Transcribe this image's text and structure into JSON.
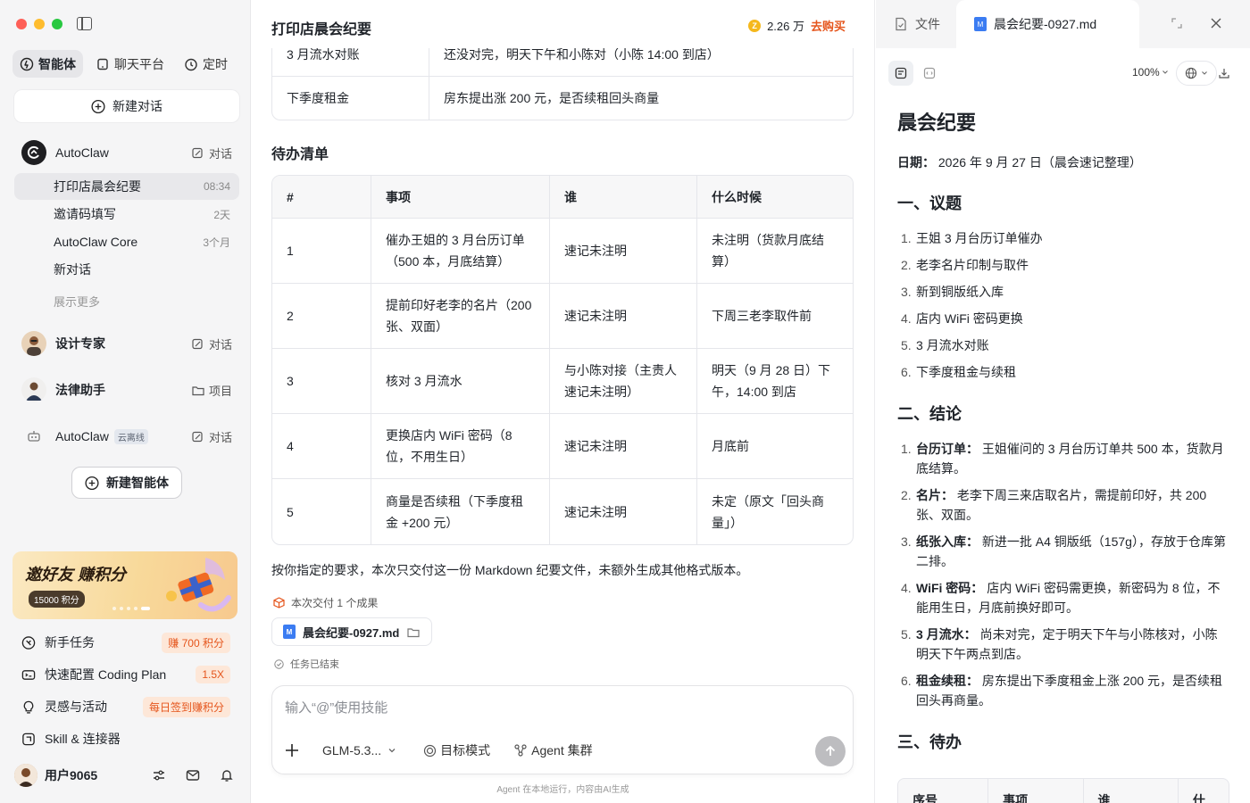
{
  "sidebar": {
    "tabs": [
      {
        "label": "智能体",
        "icon": "agent-icon"
      },
      {
        "label": "聊天平台",
        "icon": "chat-platform-icon"
      },
      {
        "label": "定时",
        "icon": "clock-icon"
      }
    ],
    "new_chat": "新建对话",
    "agents": {
      "autoclaw": {
        "name": "AutoClaw",
        "action": "对话"
      },
      "design": {
        "name": "设计专家",
        "action": "对话"
      },
      "legal": {
        "name": "法律助手",
        "action": "项目"
      },
      "cloud": {
        "name": "AutoClaw",
        "badge": "云离线",
        "action": "对话"
      }
    },
    "conversations": [
      {
        "title": "打印店晨会纪要",
        "time": "08:34"
      },
      {
        "title": "邀请码填写",
        "time": "2天"
      },
      {
        "title": "AutoClaw Core",
        "time": "3个月"
      },
      {
        "title": "新对话",
        "time": ""
      }
    ],
    "show_more": "展示更多",
    "new_agent": "新建智能体",
    "banner": {
      "title": "邀好友 赚积分",
      "pill": "15000 积分"
    },
    "menu": [
      {
        "label": "新手任务",
        "badge": "赚 700 积分",
        "icon": "task-icon"
      },
      {
        "label": "快速配置 Coding Plan",
        "badge": "1.5X",
        "icon": "code-icon"
      },
      {
        "label": "灵感与活动",
        "badge": "每日签到赚积分",
        "icon": "bulb-icon"
      },
      {
        "label": "Skill & 连接器",
        "badge": "",
        "icon": "plug-icon"
      }
    ],
    "user": {
      "name": "用户9065"
    }
  },
  "main": {
    "title": "打印店晨会纪要",
    "points": "2.26 万",
    "buy": "去购买",
    "prev_table": [
      {
        "item": "3 月流水对账",
        "note": "还没对完，明天下午和小陈对（小陈 14:00 到店）"
      },
      {
        "item": "下季度租金",
        "note": "房东提出涨 200 元，是否续租回头商量"
      }
    ],
    "todo_heading": "待办清单",
    "todo_headers": [
      "#",
      "事项",
      "谁",
      "什么时候"
    ],
    "todo_rows": [
      {
        "n": "1",
        "item": "催办王姐的 3 月台历订单（500 本，月底结算）",
        "who": "速记未注明",
        "when": "未注明（货款月底结算）"
      },
      {
        "n": "2",
        "item": "提前印好老李的名片（200 张、双面）",
        "who": "速记未注明",
        "when": "下周三老李取件前"
      },
      {
        "n": "3",
        "item": "核对 3 月流水",
        "who": "与小陈对接（主责人速记未注明）",
        "when": "明天（9 月 28 日）下午，14:00 到店"
      },
      {
        "n": "4",
        "item": "更换店内 WiFi 密码（8 位，不用生日）",
        "who": "速记未注明",
        "when": "月底前"
      },
      {
        "n": "5",
        "item": "商量是否续租（下季度租金 +200 元）",
        "who": "速记未注明",
        "when": "未定（原文「回头商量」）"
      }
    ],
    "summary": "按你指定的要求，本次只交付这一份 Markdown 纪要文件，未额外生成其他格式版本。",
    "deliver_label": "本次交付 1 个成果",
    "file_name": "晨会纪要-0927.md",
    "task_status": "任务已结束",
    "composer": {
      "placeholder": "输入“@”使用技能",
      "model": "GLM-5.3...",
      "goal_mode": "目标模式",
      "agent_cluster": "Agent 集群"
    },
    "footnote": "Agent 在本地运行，内容由AI生成"
  },
  "right": {
    "tab_files": "文件",
    "tab_doc": "晨会纪要-0927.md",
    "zoom": "100%",
    "doc": {
      "title": "晨会纪要",
      "date_label": "日期：",
      "date_value": "2026 年 9 月 27 日（晨会速记整理）",
      "sec1": "一、议题",
      "agenda": [
        "王姐 3 月台历订单催办",
        "老李名片印制与取件",
        "新到铜版纸入库",
        "店内 WiFi 密码更换",
        "3 月流水对账",
        "下季度租金与续租"
      ],
      "sec2": "二、结论",
      "conclusions": [
        {
          "k": "台历订单：",
          "v": "王姐催问的 3 月台历订单共 500 本，货款月底结算。"
        },
        {
          "k": "名片：",
          "v": "老李下周三来店取名片，需提前印好，共 200 张、双面。"
        },
        {
          "k": "纸张入库：",
          "v": "新进一批 A4 铜版纸（157g），存放于仓库第二排。"
        },
        {
          "k": "WiFi 密码：",
          "v": "店内 WiFi 密码需更换，新密码为 8 位，不能用生日，月底前换好即可。"
        },
        {
          "k": "3 月流水：",
          "v": "尚未对完，定于明天下午与小陈核对，小陈明天下午两点到店。"
        },
        {
          "k": "租金续租：",
          "v": "房东提出下季度租金上涨 200 元，是否续租回头再商量。"
        }
      ],
      "sec3": "三、待办",
      "table_headers": [
        "序号",
        "事项",
        "谁",
        "什么"
      ]
    }
  }
}
